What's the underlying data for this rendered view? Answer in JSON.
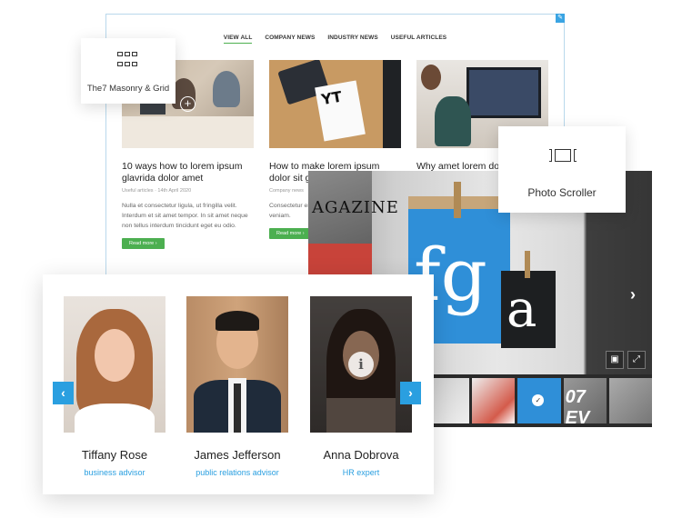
{
  "blog": {
    "filters": [
      "VIEW ALL",
      "COMPANY NEWS",
      "INDUSTRY NEWS",
      "USEFUL ARTICLES"
    ],
    "active_filter": "VIEW ALL",
    "posts": [
      {
        "title": "10 ways how to lorem ipsum glavrida dolor amet",
        "meta": "Useful articles · 14th April 2020",
        "excerpt": "Nulla et consectetur ligula, ut fringilla velit. Interdum et sit amet tempor. In sit amet neque non tellus interdum tincidunt eget eu odio.",
        "button": "Read more ›"
      },
      {
        "title": "How to make lorem ipsum dolor sit g",
        "meta": "Company news",
        "excerpt": "Consectetur eiusmod tem dolore magna veniam.",
        "button": "Read more ›"
      },
      {
        "title": "Why amet lorem do",
        "meta": "",
        "excerpt": "",
        "button": ""
      }
    ]
  },
  "labels": {
    "masonry": "The7 Masonry & Grid",
    "scroller": "Photo Scroller"
  },
  "scroller": {
    "magazine_text": "AGAZINE",
    "bag_text": "fg",
    "bag_small_text": "a",
    "thumb_text": "07 EV"
  },
  "team": {
    "members": [
      {
        "name": "Tiffany Rose",
        "role": "business advisor"
      },
      {
        "name": "James Jefferson",
        "role": "public relations advisor"
      },
      {
        "name": "Anna Dobrova",
        "role": "HR expert"
      }
    ]
  },
  "icons": {
    "grid": "grid-icon",
    "film": "filmstrip-icon",
    "info": "info-icon",
    "arrow_left": "chevron-left-icon",
    "arrow_right": "chevron-right-icon",
    "fullscreen": "fullscreen-icon",
    "thumbnails": "thumbnails-icon",
    "plus": "plus-icon",
    "check": "check-icon"
  },
  "colors": {
    "accent_green": "#4caf50",
    "accent_blue": "#2a9fe0",
    "bag_blue": "#2f8fd8"
  }
}
